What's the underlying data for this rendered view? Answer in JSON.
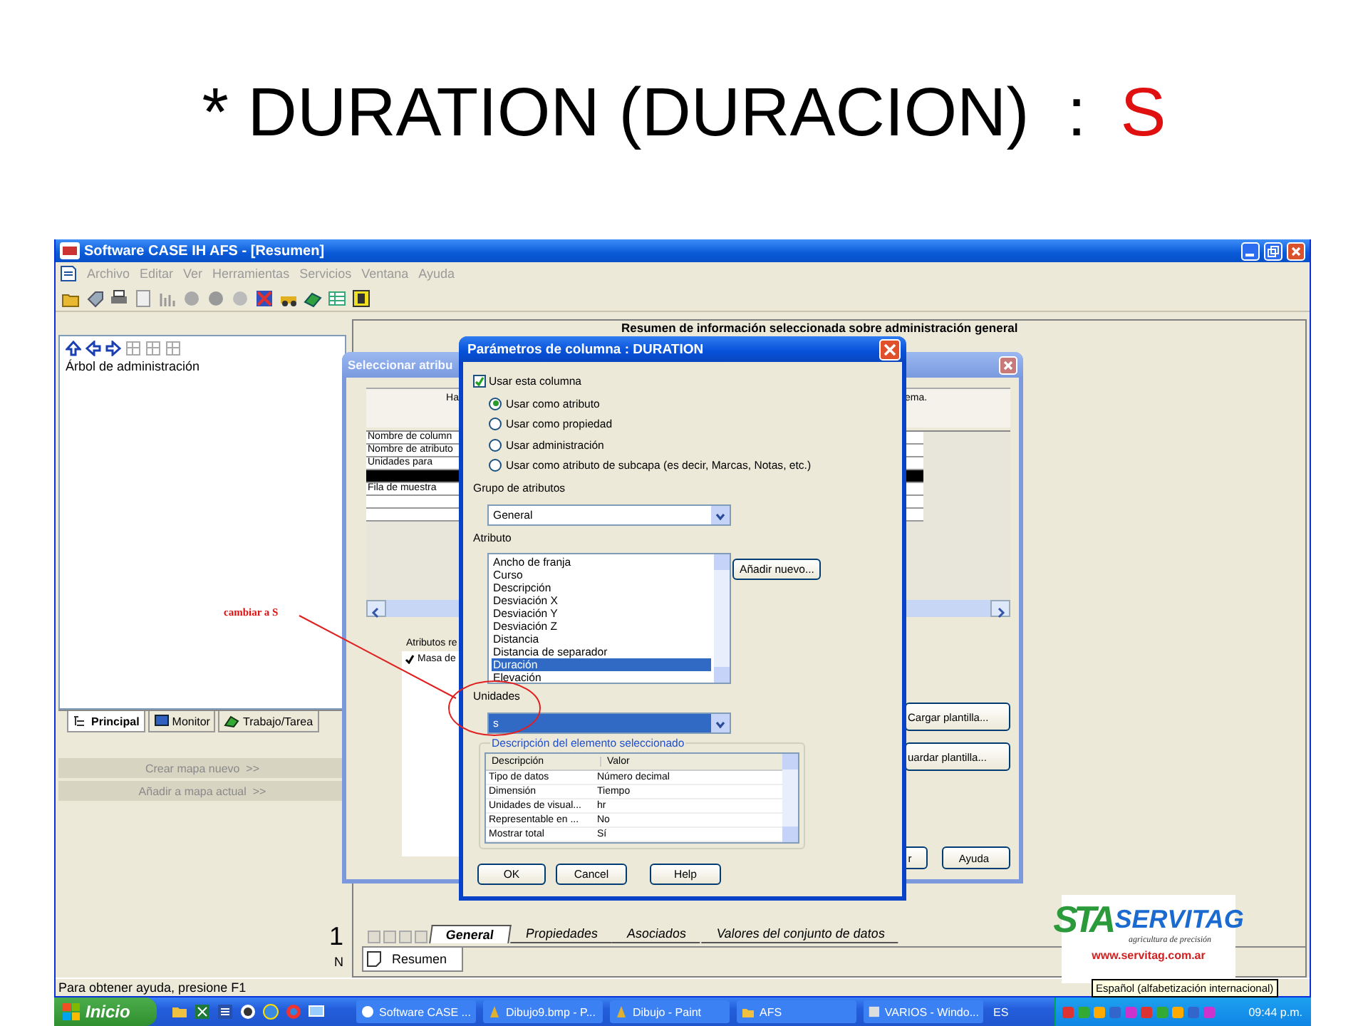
{
  "slide": {
    "title": "* DURATION (DURACION)  :",
    "value": "S"
  },
  "app": {
    "title": "Software CASE IH AFS - [Resumen]",
    "menu": [
      {
        "label": "Archivo",
        "disabled": true
      },
      {
        "label": "Editar",
        "disabled": true
      },
      {
        "label": "Ver",
        "disabled": true
      },
      {
        "label": "Herramientas",
        "disabled": true
      },
      {
        "label": "Servicios",
        "disabled": true
      },
      {
        "label": "Ventana",
        "disabled": true
      },
      {
        "label": "Ayuda",
        "disabled": true
      }
    ],
    "tree_label": "Árbol de administración",
    "left_tabs": [
      {
        "label": "Principal",
        "selected": true
      },
      {
        "label": "Monitor",
        "selected": false
      },
      {
        "label": "Trabajo/Tarea",
        "selected": false
      }
    ],
    "left_buttons": [
      {
        "label": "Crear mapa nuevo  >>",
        "disabled": true
      },
      {
        "label": "Añadir a mapa actual  >>",
        "disabled": true
      }
    ],
    "summary_heading": "Resumen de información seleccionada sobre administración general",
    "ruler": [
      "1",
      "N"
    ],
    "sheet_tabs": [
      {
        "label": "General",
        "selected": true
      },
      {
        "label": "Propiedades",
        "selected": false
      },
      {
        "label": "Asociados",
        "selected": false
      },
      {
        "label": "Valores del conjunto de datos",
        "selected": false
      }
    ],
    "view_tab": "Resumen",
    "status_bar": "Para obtener ayuda, presione F1"
  },
  "select_dialog": {
    "title": "Seleccionar atribu",
    "hint_left": "Ha",
    "hint_right": "ema.",
    "rows": [
      {
        "label": "Nombre de column",
        "selected": false
      },
      {
        "label": "Nombre de atributo",
        "selected": false
      },
      {
        "label": "Unidades para",
        "selected": false
      },
      {
        "selected": true
      },
      {
        "label": "Fila de muestra",
        "selected": false
      }
    ],
    "attributes_label": "Atributos re",
    "attributes": [
      {
        "label": "Masa de",
        "checked": true
      }
    ],
    "side_buttons": [
      "Cargar plantilla...",
      "uardar plantilla..."
    ],
    "bottom_buttons": [
      "r",
      "Ayuda"
    ]
  },
  "param_dialog": {
    "title": "Parámetros de columna : DURATION",
    "use_column": {
      "label": "Usar esta columna",
      "checked": true
    },
    "modes": [
      {
        "label": "Usar como atributo",
        "selected": true
      },
      {
        "label": "Usar como propiedad",
        "selected": false
      },
      {
        "label": "Usar administración",
        "selected": false
      },
      {
        "label": "Usar como atributo de subcapa (es decir, Marcas, Notas, etc.)",
        "selected": false
      }
    ],
    "group_label": "Grupo de atributos",
    "group_value": "General",
    "attribute_label": "Atributo",
    "attributes": [
      {
        "label": "Ancho de franja",
        "selected": false
      },
      {
        "label": "Curso",
        "selected": false
      },
      {
        "label": "Descripción",
        "selected": false
      },
      {
        "label": "Desviación X",
        "selected": false
      },
      {
        "label": "Desviación Y",
        "selected": false
      },
      {
        "label": "Desviación Z",
        "selected": false
      },
      {
        "label": "Distancia",
        "selected": false
      },
      {
        "label": "Distancia de separador",
        "selected": false
      },
      {
        "label": "Duración",
        "selected": true
      },
      {
        "label": "Elevación",
        "selected": false
      }
    ],
    "add_button": "Añadir nuevo...",
    "units_label": "Unidades",
    "units_value": "s",
    "description_legend": "Descripción del elemento seleccionado",
    "description_columns": [
      "Descripción",
      "Valor"
    ],
    "description_rows": [
      {
        "name": "Tipo de datos",
        "value": "Número decimal"
      },
      {
        "name": "Dimensión",
        "value": "Tiempo"
      },
      {
        "name": "Unidades de visual...",
        "value": "hr"
      },
      {
        "name": "Representable en ...",
        "value": "No"
      },
      {
        "name": "Mostrar total",
        "value": "Sí"
      }
    ],
    "buttons": [
      "OK",
      "Cancel",
      "Help"
    ]
  },
  "annotation": "cambiar a S",
  "logo": {
    "mark": "STA",
    "name": "SERVITAG",
    "tagline": "agricultura de precisión",
    "url": "www.servitag.com.ar"
  },
  "taskbar": {
    "start": "Inicio",
    "windows": [
      "Software CASE ...",
      "Dibujo9.bmp - P...",
      "Dibujo - Paint",
      "AFS",
      "VARIOS - Windo..."
    ],
    "language": "ES",
    "clock": "09:44 p.m."
  },
  "tooltip": "Español (alfabetización internacional)"
}
